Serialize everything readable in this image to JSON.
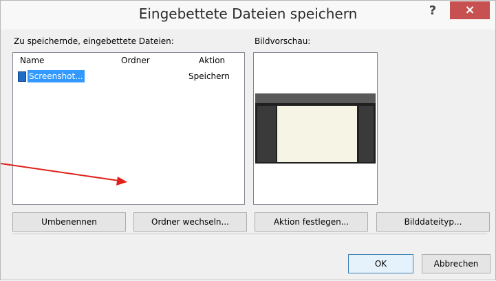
{
  "window": {
    "title": "Eingebettete Dateien speichern",
    "help_glyph": "?",
    "close_glyph": "×"
  },
  "files_section": {
    "label": "Zu speichernde, eingebettete Dateien:",
    "columns": [
      "Name",
      "Ordner",
      "Aktion"
    ],
    "rows": [
      {
        "name": "Screenshot...",
        "folder": "",
        "action": "Speichern",
        "icon": "image-file-icon",
        "selected": true
      }
    ]
  },
  "preview_section": {
    "label": "Bildvorschau:"
  },
  "buttons": {
    "rename": "Umbenennen",
    "change_folder": "Ordner wechseln...",
    "set_action": "Aktion festlegen...",
    "image_type": "Bilddateityp...",
    "ok": "OK",
    "cancel": "Abbrechen"
  },
  "colors": {
    "selection": "#3399ff",
    "close_button": "#c75050",
    "annotation_arrow": "#e0201a"
  }
}
